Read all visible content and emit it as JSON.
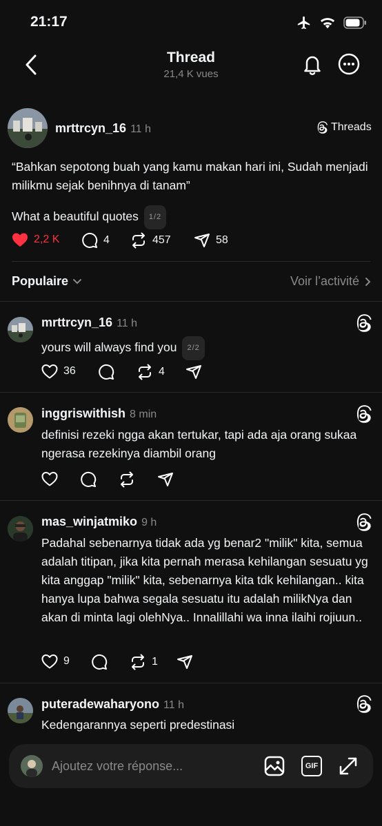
{
  "status": {
    "time": "21:17"
  },
  "nav": {
    "title": "Thread",
    "views": "21,4 K vues"
  },
  "post": {
    "username": "mrttrcyn_16",
    "time": "11 h",
    "source": "Threads",
    "quote": "“Bahkan sepotong buah yang kamu makan hari ini, Sudah menjadi milikmu sejak benihnya di tanam”",
    "caption": "What a beautiful quotes",
    "pager": "1/2",
    "likes": "2,2 K",
    "comments": "4",
    "reposts": "457",
    "shares": "58"
  },
  "sort": {
    "label": "Populaire",
    "activity": "Voir l’activité"
  },
  "replies": [
    {
      "username": "mrttrcyn_16",
      "time": "11 h",
      "text": "yours will always find you",
      "pager": "2/2",
      "likes": "36",
      "comments": "",
      "reposts": "4",
      "shares": ""
    },
    {
      "username": "inggriswithish",
      "time": "8 min",
      "text": "definisi rezeki ngga akan tertukar, tapi ada aja orang sukaa ngerasa rezekinya diambil orang",
      "likes": "",
      "comments": "",
      "reposts": "",
      "shares": ""
    },
    {
      "username": "mas_winjatmiko",
      "time": "9 h",
      "text": "Padahal sebenarnya tidak ada yg benar2 \"milik\" kita, semua adalah titipan, jika kita pernah merasa kehilangan sesuatu yg kita anggap \"milik\" kita, sebenarnya kita tdk kehilangan.. kita hanya lupa bahwa segala sesuatu itu adalah milikNya dan akan di minta lagi olehNya.. Innalillahi wa inna ilaihi rojiuun..",
      "likes": "9",
      "comments": "",
      "reposts": "1",
      "shares": ""
    },
    {
      "username": "puteradewaharyono",
      "time": "11 h",
      "text": "Kedengarannya seperti predestinasi"
    }
  ],
  "reply_bar": {
    "placeholder": "Ajoutez votre réponse...",
    "gif": "GIF"
  },
  "colors": {
    "like_active": "#ff3040",
    "background": "#101010",
    "secondary": "#8a8a8a"
  },
  "icons": [
    "airplane-icon",
    "wifi-icon",
    "battery-icon",
    "back-icon",
    "bell-icon",
    "more-icon",
    "threads-logo-icon",
    "heart-icon",
    "comment-icon",
    "repost-icon",
    "share-icon",
    "chevron-down-icon",
    "chevron-right-icon",
    "image-icon",
    "gif-icon",
    "expand-icon"
  ]
}
